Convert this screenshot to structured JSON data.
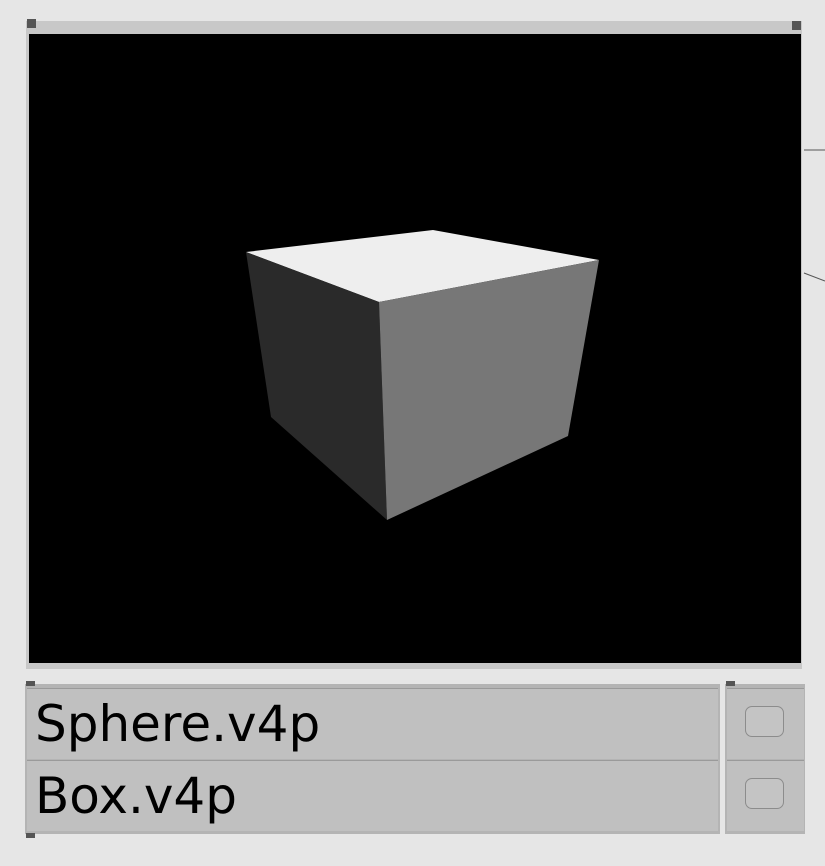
{
  "renderer": {
    "background_color": "#000000",
    "scene_object": "cube",
    "face_colors": {
      "top": "#eeeeee",
      "left": "#2a2a2a",
      "right": "#777777"
    }
  },
  "file_list": {
    "items": [
      {
        "label": "Sphere.v4p",
        "enabled": false
      },
      {
        "label": "Box.v4p",
        "enabled": false
      }
    ]
  }
}
